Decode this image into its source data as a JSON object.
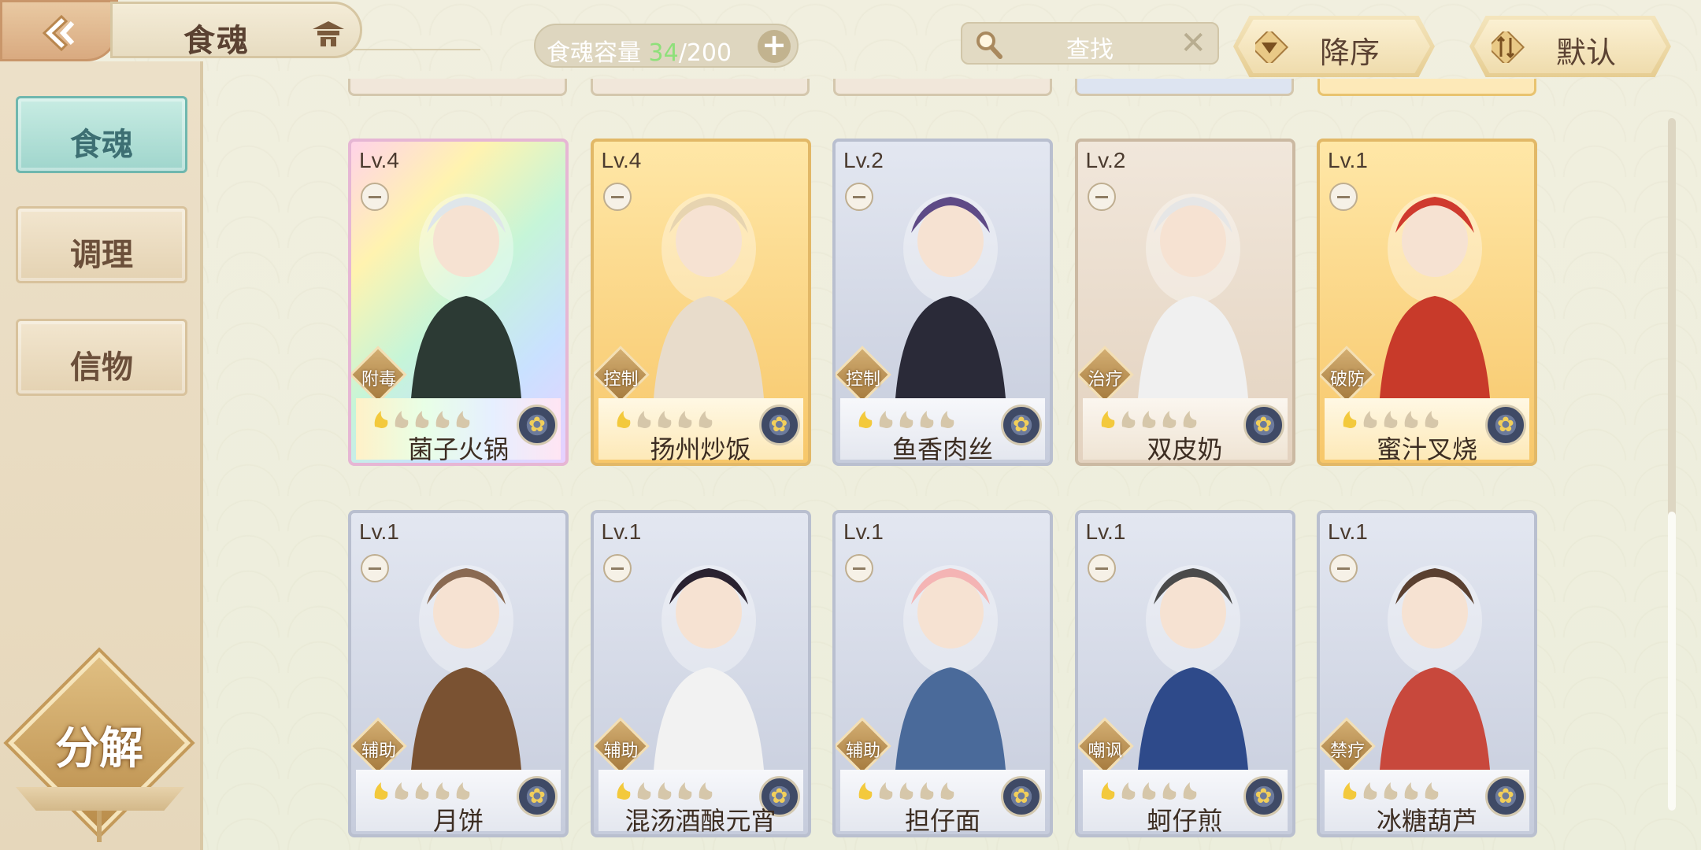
{
  "header": {
    "title": "食魂",
    "capacity_label": "食魂容量",
    "capacity_current": "34",
    "capacity_max": "/200",
    "add_symbol": "+",
    "search_placeholder": "查找",
    "clear_symbol": "✕",
    "sort_order_label": "降序",
    "sort_mode_label": "默认"
  },
  "sidebar": {
    "tabs": [
      {
        "label": "食魂",
        "active": true
      },
      {
        "label": "调理",
        "active": false
      },
      {
        "label": "信物",
        "active": false
      }
    ],
    "decompose_label": "分解"
  },
  "cards": [
    {
      "name": "菌子火锅",
      "level": "Lv.4",
      "role": "附毒",
      "frame": "rainbow"
    },
    {
      "name": "扬州炒饭",
      "level": "Lv.4",
      "role": "控制",
      "frame": "gold"
    },
    {
      "name": "鱼香肉丝",
      "level": "Lv.2",
      "role": "控制",
      "frame": "silver"
    },
    {
      "name": "双皮奶",
      "level": "Lv.2",
      "role": "治疗",
      "frame": "bronze"
    },
    {
      "name": "蜜汁叉烧",
      "level": "Lv.1",
      "role": "破防",
      "frame": "gold"
    },
    {
      "name": "月饼",
      "level": "Lv.1",
      "role": "辅助",
      "frame": "silver"
    },
    {
      "name": "混汤酒酿元宵",
      "level": "Lv.1",
      "role": "辅助",
      "frame": "silver"
    },
    {
      "name": "担仔面",
      "level": "Lv.1",
      "role": "辅助",
      "frame": "silver"
    },
    {
      "name": "蚵仔煎",
      "level": "Lv.1",
      "role": "嘲讽",
      "frame": "silver"
    },
    {
      "name": "冰糖葫芦",
      "level": "Lv.1",
      "role": "禁疗",
      "frame": "silver"
    }
  ],
  "colors": {
    "active_tab": "#9fd5cc",
    "capacity_current": "#8ee07a",
    "gold_frame": "#f7c76a"
  },
  "icons": {
    "back": "back-arrow-icon",
    "title": "pagoda-icon",
    "search": "magnifier-icon",
    "sort_order": "triangle-down-icon",
    "sort_mode": "swap-icon",
    "element": "flower-badge-icon",
    "star": "flame-star-icon"
  }
}
